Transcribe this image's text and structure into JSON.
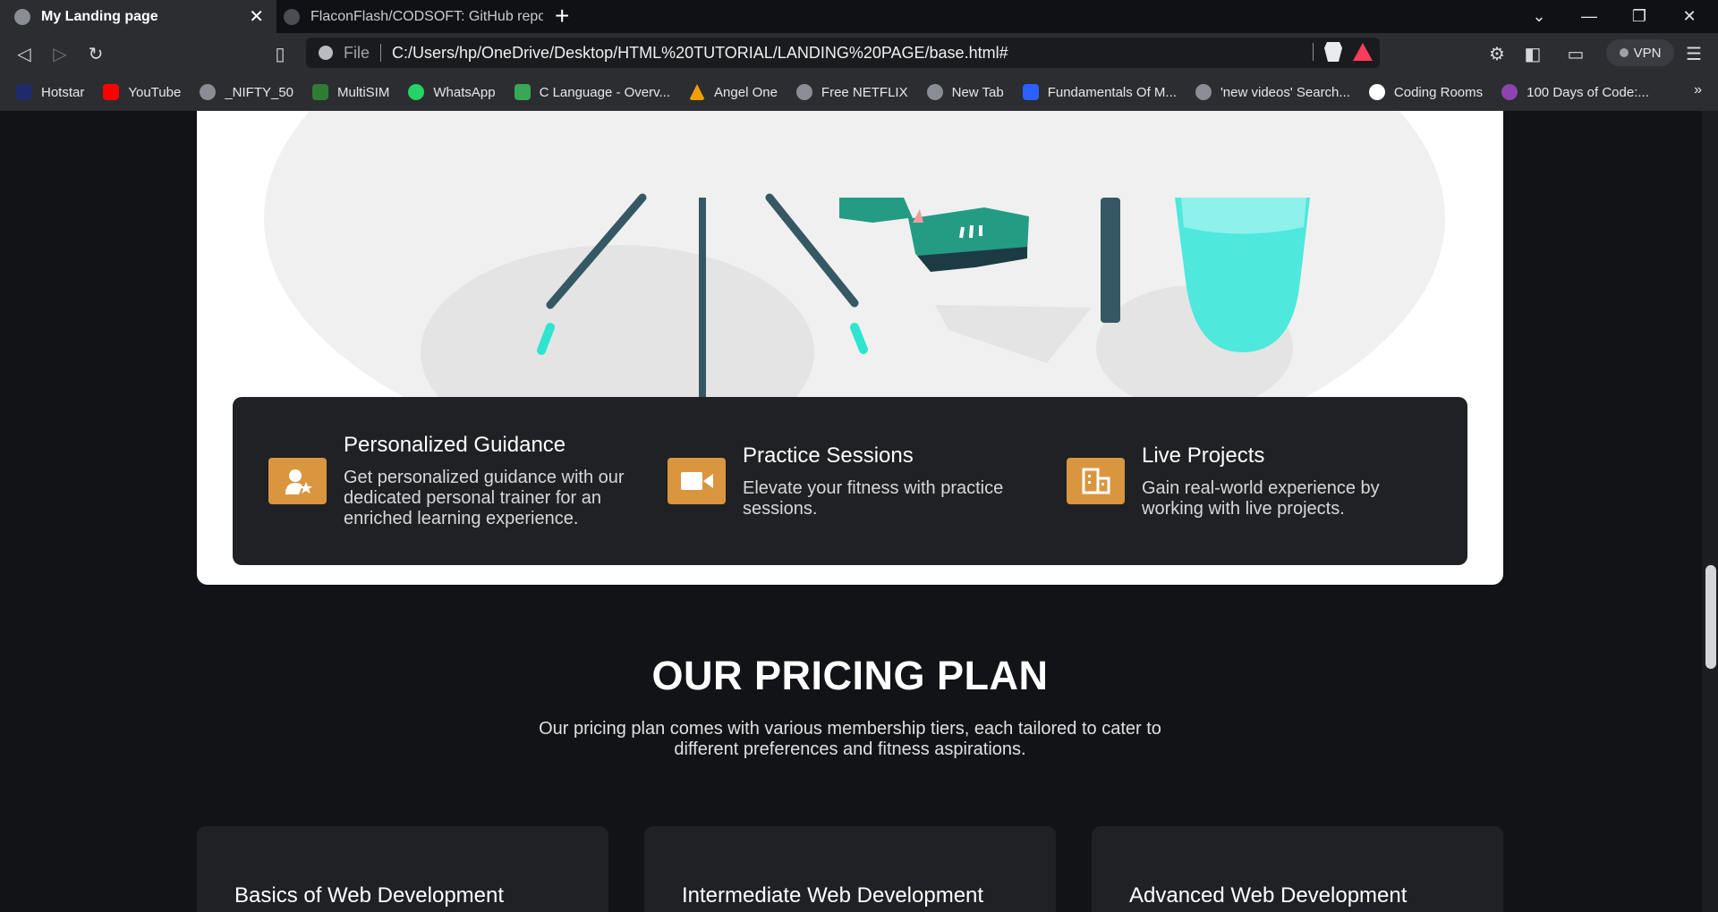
{
  "browser": {
    "tabs": [
      {
        "title": "My Landing page",
        "active": true
      },
      {
        "title": "FlaconFlash/CODSOFT: GitHub reposit",
        "active": false
      }
    ],
    "url_scheme": "File",
    "url": "C:/Users/hp/OneDrive/Desktop/HTML%20TUTORIAL/LANDING%20PAGE/base.html#",
    "vpn_label": "VPN",
    "bookmarks": [
      {
        "label": "Hotstar",
        "color": "#1f2a6b"
      },
      {
        "label": "YouTube",
        "color": "#ff0000"
      },
      {
        "label": "_NIFTY_50",
        "color": "#8a8d93"
      },
      {
        "label": "MultiSIM",
        "color": "#2e7d32"
      },
      {
        "label": "WhatsApp",
        "color": "#25d366"
      },
      {
        "label": "C Language - Overv...",
        "color": "#3aa757"
      },
      {
        "label": "Angel One",
        "color": "#f29f05"
      },
      {
        "label": "Free NETFLIX",
        "color": "#8a8d93"
      },
      {
        "label": "New Tab",
        "color": "#8a8d93"
      },
      {
        "label": "Fundamentals Of M...",
        "color": "#2962ff"
      },
      {
        "label": "'new videos' Search...",
        "color": "#8a8d93"
      },
      {
        "label": "Coding Rooms",
        "color": "#ffffff"
      },
      {
        "label": "100 Days of Code:...",
        "color": "#8e44ad"
      }
    ],
    "bookmarks_more": "»"
  },
  "features": [
    {
      "title": "Personalized Guidance",
      "description": "Get personalized guidance with our dedicated personal trainer for an enriched learning experience.",
      "icon": "trainer-icon"
    },
    {
      "title": "Practice Sessions",
      "description": "Elevate your fitness with practice sessions.",
      "icon": "video-camera-icon"
    },
    {
      "title": "Live Projects",
      "description": "Gain real-world experience by working with live projects.",
      "icon": "building-icon"
    }
  ],
  "pricing": {
    "title": "OUR PRICING PLAN",
    "subtitle": "Our pricing plan comes with various membership tiers, each tailored to cater to different preferences and fitness aspirations.",
    "plans": [
      {
        "title": "Basics of Web Development"
      },
      {
        "title": "Intermediate Web Development"
      },
      {
        "title": "Advanced Web Development"
      }
    ]
  },
  "colors": {
    "accent": "#d9963f",
    "card_bg": "#202124",
    "page_bg": "#111317",
    "illustration_teal": "#4ee8dc"
  }
}
